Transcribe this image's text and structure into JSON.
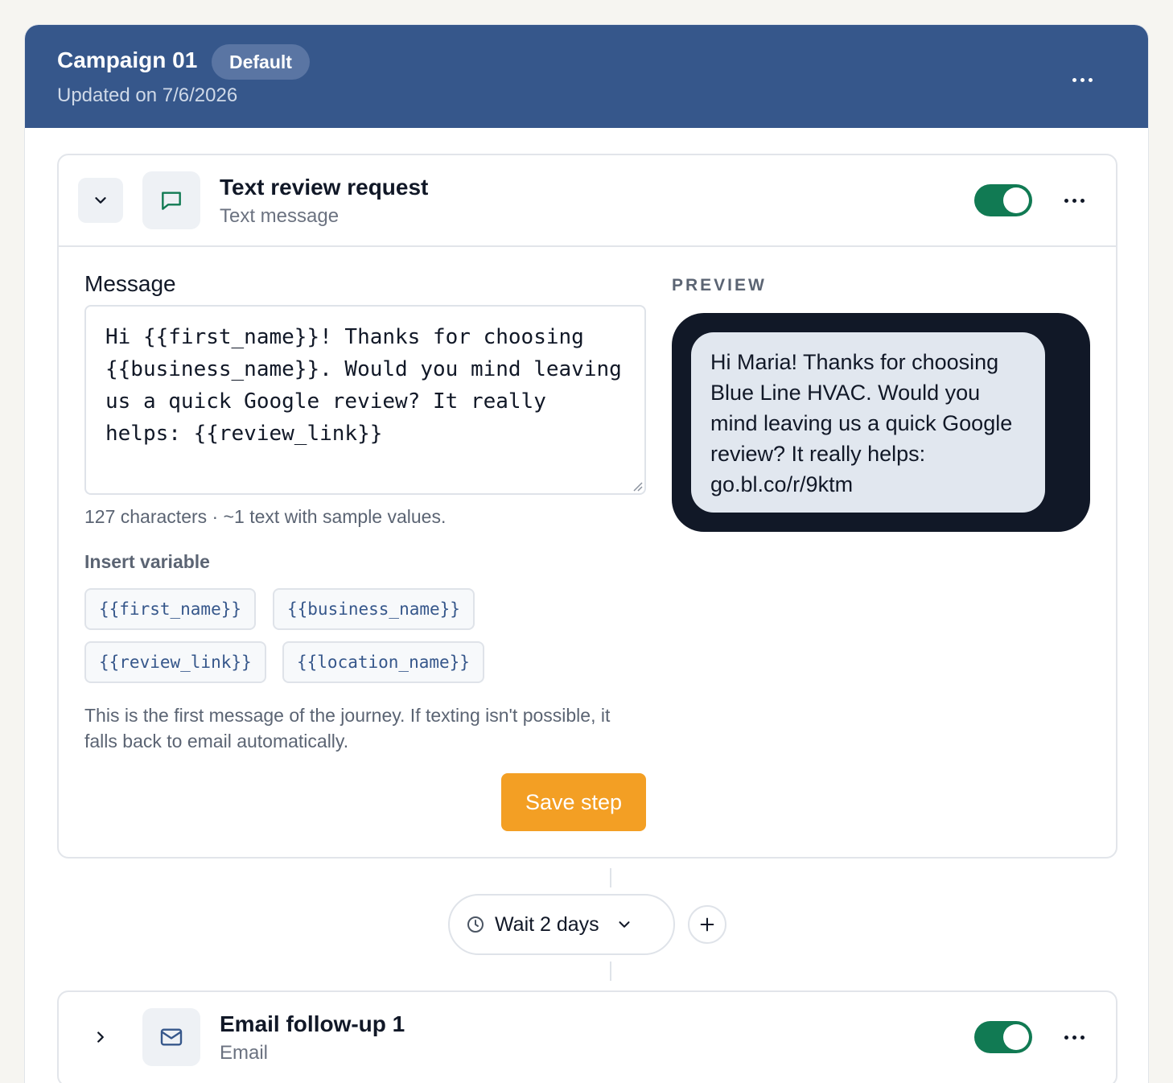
{
  "campaign": {
    "title": "Campaign 01",
    "badge": "Default",
    "updated": "Updated on 7/6/2026"
  },
  "steps": [
    {
      "title": "Text review request",
      "subtitle": "Text message",
      "enabled": true,
      "message_label": "Message",
      "message_value": "Hi {{first_name}}! Thanks for choosing {{business_name}}. Would you mind leaving us a quick Google review? It really helps: {{review_link}}",
      "count_text": "127 characters · ~1 text with sample values.",
      "insert_label": "Insert variable",
      "variables": [
        "{{first_name}}",
        "{{business_name}}",
        "{{review_link}}",
        "{{location_name}}"
      ],
      "help_text": "This is the first message of the journey. If texting isn't possible, it falls back to email automatically.",
      "save_label": "Save step",
      "preview_label": "PREVIEW",
      "preview_text": "Hi Maria! Thanks for choosing Blue Line HVAC. Would you mind leaving us a quick Google review? It really helps: go.bl.co/r/9ktm"
    },
    {
      "title": "Email follow-up 1",
      "subtitle": "Email",
      "enabled": true
    }
  ],
  "wait": {
    "label": "Wait 2 days"
  },
  "colors": {
    "header": "#36578b",
    "toggle_on": "#117a53",
    "save_button": "#f39f24",
    "phone": "#111827",
    "bubble": "#e1e7ef"
  },
  "icons": {
    "header_more": "more-horizontal-icon",
    "step1_collapse": "chevron-down-icon",
    "step1_type": "message-square-icon",
    "step2_expand": "chevron-right-icon",
    "step2_type": "mail-icon",
    "wait": "clock-icon",
    "wait_dropdown": "chevron-down-icon",
    "add": "plus-icon"
  }
}
